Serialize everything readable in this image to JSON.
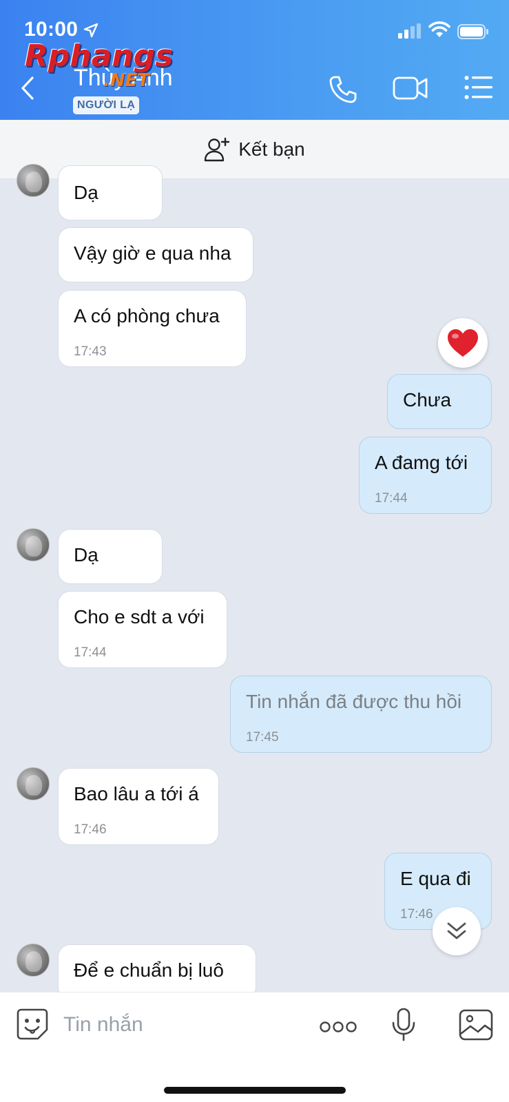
{
  "status_bar": {
    "time": "10:00"
  },
  "header": {
    "contact_name": "Thùy Anh",
    "badge": "NGƯỜI LẠ",
    "watermark_main": "Rphangs",
    "watermark_net": ".NET"
  },
  "friend_bar": {
    "label": "Kết bạn"
  },
  "messages": [
    {
      "dir": "in",
      "text": "Dạ",
      "time": ""
    },
    {
      "dir": "in",
      "text": "Vậy giờ e qua nha",
      "time": ""
    },
    {
      "dir": "in",
      "text": "A có phòng chưa",
      "time": "17:43"
    },
    {
      "dir": "out",
      "text": "Chưa",
      "time": ""
    },
    {
      "dir": "out",
      "text": "A đamg tới",
      "time": "17:44"
    },
    {
      "dir": "in",
      "text": "Dạ",
      "time": ""
    },
    {
      "dir": "in",
      "text": "Cho e sdt a với",
      "time": "17:44"
    },
    {
      "dir": "out",
      "text": "Tin nhắn đã được thu hồi",
      "time": "17:45"
    },
    {
      "dir": "in",
      "text": "Bao lâu a tới á",
      "time": "17:46"
    },
    {
      "dir": "out",
      "text": "E qua đi",
      "time": "17:46"
    },
    {
      "dir": "in",
      "text": "Để e chuẩn bị luô",
      "time": ""
    }
  ],
  "composer": {
    "placeholder": "Tin nhắn"
  },
  "icons": {
    "back": "chevron-left-icon",
    "phone": "phone-icon",
    "video": "video-camera-icon",
    "menu": "list-menu-icon",
    "add_friend": "add-person-icon",
    "reaction": "heart-icon",
    "scroll": "double-chevron-down-icon",
    "sticker": "sticker-face-icon",
    "more": "more-dots-icon",
    "mic": "microphone-icon",
    "gallery": "image-gallery-icon"
  },
  "colors": {
    "header_blue": "#3b82f0",
    "outgoing_bubble": "#d5ebfb",
    "incoming_bubble": "#ffffff",
    "chat_background": "#e3e7ef",
    "heart": "#e0212e"
  }
}
